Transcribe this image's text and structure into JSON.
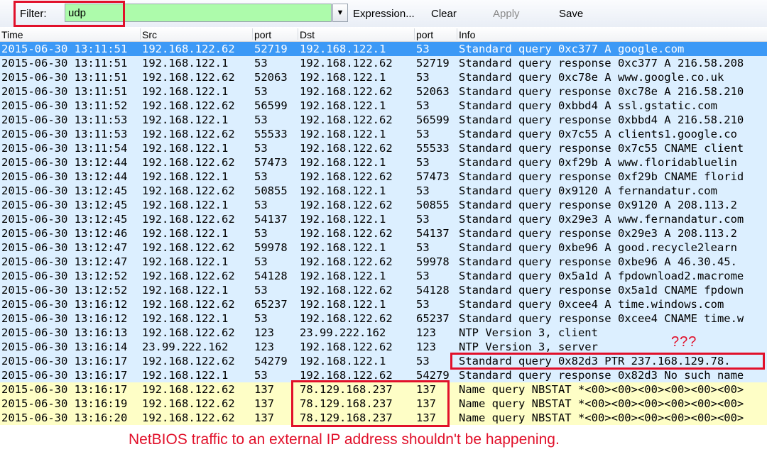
{
  "toolbar": {
    "filter_label": "Filter:",
    "filter_value": "udp",
    "dropdown_glyph": "▼",
    "expression_label": "Expression...",
    "clear_label": "Clear",
    "apply_label": "Apply",
    "save_label": "Save"
  },
  "columns": [
    "Time",
    "Src",
    "port",
    "Dst",
    "port",
    "Info"
  ],
  "packets": [
    {
      "time": "2015-06-30 13:11:51",
      "src": "192.168.122.62",
      "sport": "52719",
      "dst": "192.168.122.1",
      "dport": "53",
      "info": "Standard query 0xc377  A google.com",
      "type": "selected"
    },
    {
      "time": "2015-06-30 13:11:51",
      "src": "192.168.122.1",
      "sport": "53",
      "dst": "192.168.122.62",
      "dport": "52719",
      "info": "Standard query response 0xc377  A 216.58.208",
      "type": "dns"
    },
    {
      "time": "2015-06-30 13:11:51",
      "src": "192.168.122.62",
      "sport": "52063",
      "dst": "192.168.122.1",
      "dport": "53",
      "info": "Standard query 0xc78e  A www.google.co.uk",
      "type": "dns"
    },
    {
      "time": "2015-06-30 13:11:51",
      "src": "192.168.122.1",
      "sport": "53",
      "dst": "192.168.122.62",
      "dport": "52063",
      "info": "Standard query response 0xc78e  A 216.58.210",
      "type": "dns"
    },
    {
      "time": "2015-06-30 13:11:52",
      "src": "192.168.122.62",
      "sport": "56599",
      "dst": "192.168.122.1",
      "dport": "53",
      "info": "Standard query 0xbbd4  A ssl.gstatic.com",
      "type": "dns"
    },
    {
      "time": "2015-06-30 13:11:53",
      "src": "192.168.122.1",
      "sport": "53",
      "dst": "192.168.122.62",
      "dport": "56599",
      "info": "Standard query response 0xbbd4  A 216.58.210",
      "type": "dns"
    },
    {
      "time": "2015-06-30 13:11:53",
      "src": "192.168.122.62",
      "sport": "55533",
      "dst": "192.168.122.1",
      "dport": "53",
      "info": "Standard query 0x7c55  A clients1.google.co",
      "type": "dns"
    },
    {
      "time": "2015-06-30 13:11:54",
      "src": "192.168.122.1",
      "sport": "53",
      "dst": "192.168.122.62",
      "dport": "55533",
      "info": "Standard query response 0x7c55  CNAME client",
      "type": "dns"
    },
    {
      "time": "2015-06-30 13:12:44",
      "src": "192.168.122.62",
      "sport": "57473",
      "dst": "192.168.122.1",
      "dport": "53",
      "info": "Standard query 0xf29b  A www.floridabluelin",
      "type": "dns"
    },
    {
      "time": "2015-06-30 13:12:44",
      "src": "192.168.122.1",
      "sport": "53",
      "dst": "192.168.122.62",
      "dport": "57473",
      "info": "Standard query response 0xf29b  CNAME florid",
      "type": "dns"
    },
    {
      "time": "2015-06-30 13:12:45",
      "src": "192.168.122.62",
      "sport": "50855",
      "dst": "192.168.122.1",
      "dport": "53",
      "info": "Standard query 0x9120  A fernandatur.com",
      "type": "dns"
    },
    {
      "time": "2015-06-30 13:12:45",
      "src": "192.168.122.1",
      "sport": "53",
      "dst": "192.168.122.62",
      "dport": "50855",
      "info": "Standard query response 0x9120  A 208.113.2",
      "type": "dns"
    },
    {
      "time": "2015-06-30 13:12:45",
      "src": "192.168.122.62",
      "sport": "54137",
      "dst": "192.168.122.1",
      "dport": "53",
      "info": "Standard query 0x29e3  A www.fernandatur.com",
      "type": "dns"
    },
    {
      "time": "2015-06-30 13:12:46",
      "src": "192.168.122.1",
      "sport": "53",
      "dst": "192.168.122.62",
      "dport": "54137",
      "info": "Standard query response 0x29e3  A 208.113.2",
      "type": "dns"
    },
    {
      "time": "2015-06-30 13:12:47",
      "src": "192.168.122.62",
      "sport": "59978",
      "dst": "192.168.122.1",
      "dport": "53",
      "info": "Standard query 0xbe96  A good.recycle2learn",
      "type": "dns"
    },
    {
      "time": "2015-06-30 13:12:47",
      "src": "192.168.122.1",
      "sport": "53",
      "dst": "192.168.122.62",
      "dport": "59978",
      "info": "Standard query response 0xbe96  A 46.30.45.",
      "type": "dns"
    },
    {
      "time": "2015-06-30 13:12:52",
      "src": "192.168.122.62",
      "sport": "54128",
      "dst": "192.168.122.1",
      "dport": "53",
      "info": "Standard query 0x5a1d  A fpdownload2.macrome",
      "type": "dns"
    },
    {
      "time": "2015-06-30 13:12:52",
      "src": "192.168.122.1",
      "sport": "53",
      "dst": "192.168.122.62",
      "dport": "54128",
      "info": "Standard query response 0x5a1d  CNAME fpdown",
      "type": "dns"
    },
    {
      "time": "2015-06-30 13:16:12",
      "src": "192.168.122.62",
      "sport": "65237",
      "dst": "192.168.122.1",
      "dport": "53",
      "info": "Standard query 0xcee4  A time.windows.com",
      "type": "dns"
    },
    {
      "time": "2015-06-30 13:16:12",
      "src": "192.168.122.1",
      "sport": "53",
      "dst": "192.168.122.62",
      "dport": "65237",
      "info": "Standard query response 0xcee4  CNAME time.w",
      "type": "dns"
    },
    {
      "time": "2015-06-30 13:16:13",
      "src": "192.168.122.62",
      "sport": "123",
      "dst": "23.99.222.162",
      "dport": "123",
      "info": "NTP Version 3, client",
      "type": "ntp"
    },
    {
      "time": "2015-06-30 13:16:14",
      "src": "23.99.222.162",
      "sport": "123",
      "dst": "192.168.122.62",
      "dport": "123",
      "info": "NTP Version 3, server",
      "type": "ntp"
    },
    {
      "time": "2015-06-30 13:16:17",
      "src": "192.168.122.62",
      "sport": "54279",
      "dst": "192.168.122.1",
      "dport": "53",
      "info": "Standard query 0x82d3  PTR 237.168.129.78.",
      "type": "dns"
    },
    {
      "time": "2015-06-30 13:16:17",
      "src": "192.168.122.1",
      "sport": "53",
      "dst": "192.168.122.62",
      "dport": "54279",
      "info": "Standard query response 0x82d3 No such name",
      "type": "dns"
    },
    {
      "time": "2015-06-30 13:16:17",
      "src": "192.168.122.62",
      "sport": "137",
      "dst": "78.129.168.237",
      "dport": "137",
      "info": "Name query NBSTAT *<00><00><00><00><00><00>",
      "type": "nbns"
    },
    {
      "time": "2015-06-30 13:16:19",
      "src": "192.168.122.62",
      "sport": "137",
      "dst": "78.129.168.237",
      "dport": "137",
      "info": "Name query NBSTAT *<00><00><00><00><00><00>",
      "type": "nbns"
    },
    {
      "time": "2015-06-30 13:16:20",
      "src": "192.168.122.62",
      "sport": "137",
      "dst": "78.129.168.237",
      "dport": "137",
      "info": "Name query NBSTAT *<00><00><00><00><00><00>",
      "type": "nbns"
    }
  ],
  "annotations": {
    "question_marks": "???",
    "note": "NetBIOS traffic to an external IP address shouldn't be happening.",
    "color": "#e1102a"
  }
}
